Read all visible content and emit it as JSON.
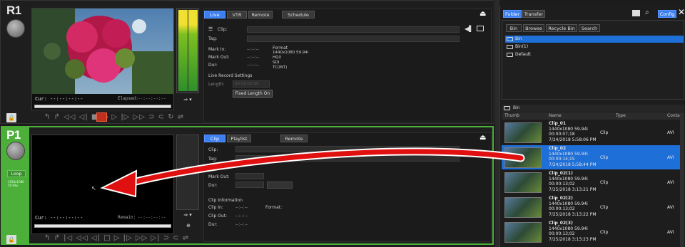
{
  "r1": {
    "label": "R1",
    "tabs": [
      "Live",
      "VTR",
      "Remote",
      "Schedule"
    ],
    "clip_label": "Clip:",
    "tag_label": "Tag:",
    "mark_in_label": "Mark In:",
    "mark_in_val": "--:--:--",
    "mark_out_label": "Mark Out:",
    "mark_out_val": "--:--:--",
    "dur_label": "Dur:",
    "dur_val": "--:--:--",
    "format_label": "Format",
    "format_lines": [
      "1440x1080 59.94i",
      "HQX",
      "SDI",
      "TC(INT)"
    ],
    "live_record_label": "Live Record Settings",
    "length_label": "Length:",
    "length_val": "00:00:00;00",
    "fixed_length_button": "Fixed Length On",
    "cur_label": "Cur:",
    "cur_val": "--:--:--:--",
    "elapsed_label": "Elapsed:",
    "elapsed_val": "--:--:--:--",
    "transport": "↰ ↱  ◁◁ ◁|  ■   ●   ▷  |▷  ▷▷   ⊃ ⊂   ↻  ⇌"
  },
  "p1": {
    "label": "P1",
    "loop_label": "Loop",
    "format_small": "1920x1080\n59.94p",
    "tabs": [
      "Clip",
      "Playlist",
      "Remote"
    ],
    "clip_label": "Clip:",
    "tag_label": "Tag:",
    "mark_out_label": "Mark Out:",
    "dur_label": "Dur:",
    "clip_info_label": "Clip Information",
    "clip_in_label": "Clip In:",
    "clip_in_val": "--:--:--",
    "clip_out_label": "Clip Out:",
    "clip_out_val": "--:--:--",
    "dur2_label": "Dur:",
    "dur2_val": "--:--:--",
    "format_label": "Format:",
    "cur_label": "Cur:",
    "cur_val": "--:--:--:--",
    "remain_label": "Remain:",
    "remain_val": "--:--:--:--",
    "transport": "↰ ↱  |◁ ◁◁ ◁|  □  ▷  |▷  ▷▷  ▷|   ⊃ ⊂   ⇌"
  },
  "right": {
    "tabs": [
      "Folder",
      "Transfer"
    ],
    "config_button": "Config",
    "subtabs": [
      "Bin",
      "Browse",
      "Recycle Bin",
      "Search"
    ],
    "tree": [
      "Bin",
      "Bin(1)",
      "Default"
    ],
    "bin_title": "Bin",
    "columns": [
      "Thumb",
      "Name",
      "Type",
      "Contain"
    ],
    "clips": [
      {
        "name": "Clip_01",
        "format": "1440x1080 59.94i",
        "dur": "00:00:07;18",
        "date": "7/24/2018 5:58:06 PM",
        "type": "Clip",
        "container": "AVI",
        "selected": false
      },
      {
        "name": "Clip_02",
        "format": "1440x1080 59.94i",
        "dur": "00:00:14;15",
        "date": "7/24/2018 5:58:44 PM",
        "type": "Clip",
        "container": "AVI",
        "selected": true
      },
      {
        "name": "Clip_02(1)",
        "format": "1440x1080 59.94i",
        "dur": "00:00:13;02",
        "date": "7/25/2018 3:13:21 PM",
        "type": "Clip",
        "container": "AVI",
        "selected": false
      },
      {
        "name": "Clip_02(2)",
        "format": "1440x1080 59.94i",
        "dur": "00:00:13;02",
        "date": "7/25/2018 3:13:22 PM",
        "type": "Clip",
        "container": "AVI",
        "selected": false
      },
      {
        "name": "Clip_02(3)",
        "format": "1440x1080 59.94i",
        "dur": "00:00:13;02",
        "date": "7/25/2018 3:13:23 PM",
        "type": "Clip",
        "container": "AVI",
        "selected": false
      }
    ]
  },
  "colors": {
    "accent": "#3c7ff0",
    "channel_green": "#4caf3a",
    "arrow_red": "#e01010",
    "selected_row": "#1e6fd8"
  }
}
